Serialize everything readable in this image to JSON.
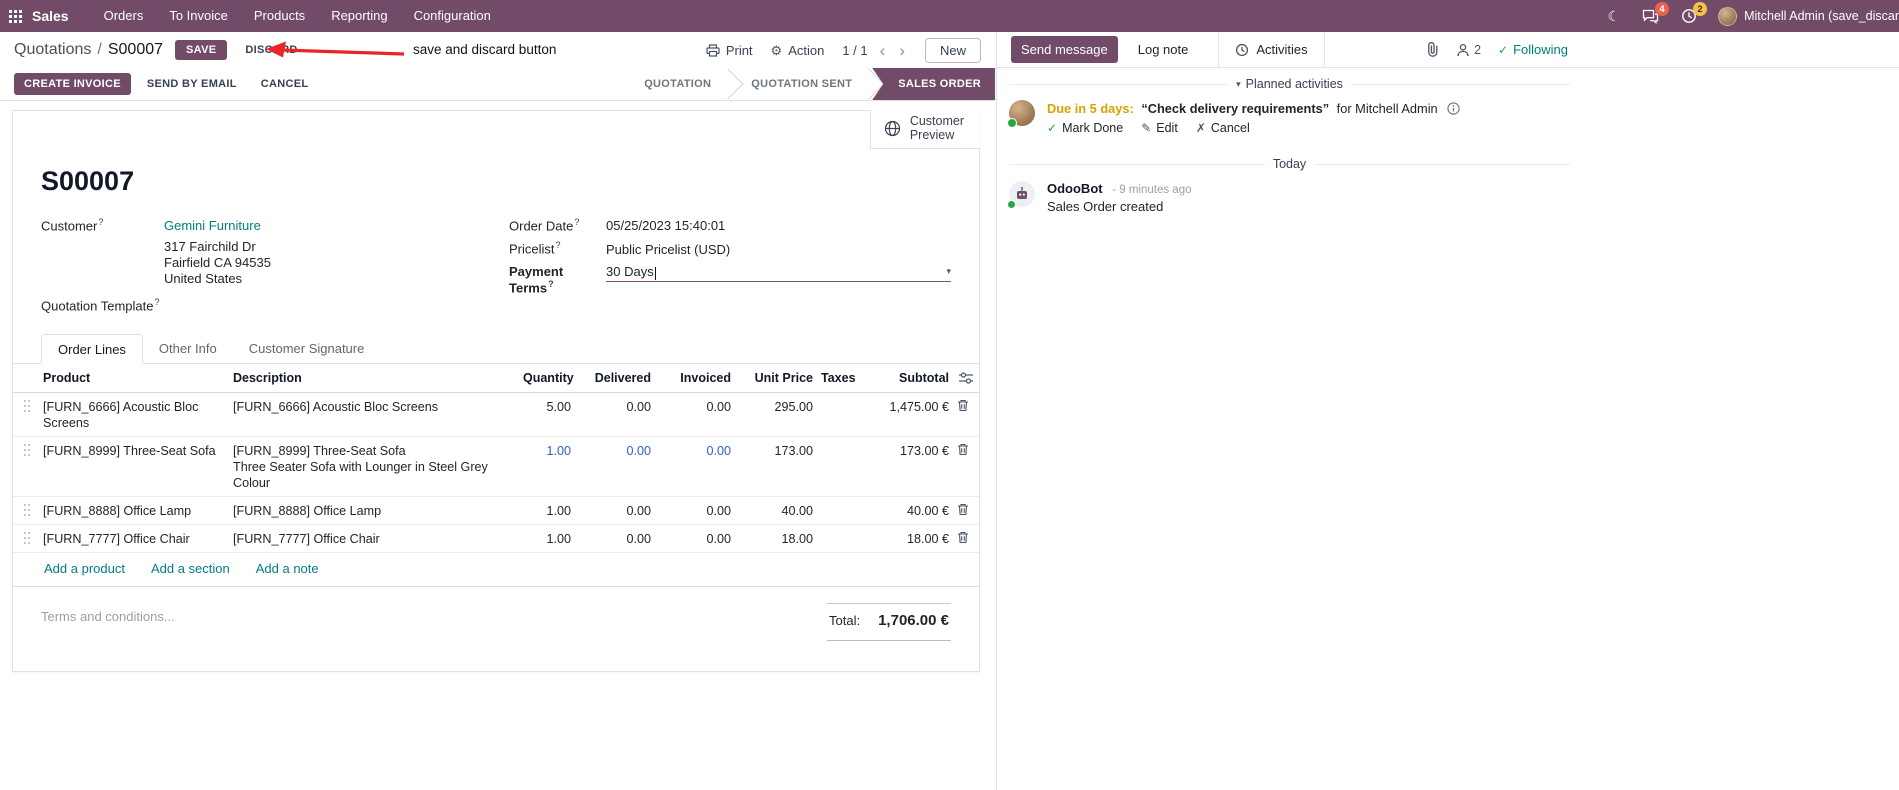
{
  "colors": {
    "primary": "#714B67",
    "link": "#017E84",
    "modified": "#2a5fd0",
    "due": "#d9a300",
    "red": "#e8252b",
    "success": "#28a745"
  },
  "icons": {
    "moon": "☾",
    "gear": "⚙",
    "chevron_left": "‹",
    "chevron_right": "›",
    "check": "✓",
    "pencil": "✎",
    "cross": "✗",
    "caret_down": "▾"
  },
  "navbar": {
    "app_name": "Sales",
    "menu_items": [
      "Orders",
      "To Invoice",
      "Products",
      "Reporting",
      "Configuration"
    ],
    "messages_badge": "4",
    "activities_badge": "2",
    "user_name": "Mitchell Admin (save_discar"
  },
  "breadcrumb": {
    "parent": "Quotations",
    "separator": "/",
    "current": "S00007"
  },
  "control_panel": {
    "save_label": "SAVE",
    "discard_label": "DISCARD",
    "print_label": "Print",
    "action_label": "Action",
    "pager": "1 / 1",
    "new_label": "New"
  },
  "annotation": {
    "text": "save and discard button"
  },
  "statusbar": {
    "buttons": [
      "CREATE INVOICE",
      "SEND BY EMAIL",
      "CANCEL"
    ],
    "states": [
      {
        "label": "QUOTATION",
        "active": false
      },
      {
        "label": "QUOTATION SENT",
        "active": false
      },
      {
        "label": "SALES ORDER",
        "active": true
      }
    ]
  },
  "sheet": {
    "customer_preview": {
      "line1": "Customer",
      "line2": "Preview"
    },
    "title": "S00007",
    "fields": {
      "help_marker": "?",
      "customer_label": "Customer",
      "customer_value": "Gemini Furniture",
      "address_lines": [
        "317 Fairchild Dr",
        "Fairfield CA 94535",
        "United States"
      ],
      "quotation_template_label": "Quotation Template",
      "order_date_label": "Order Date",
      "order_date_value": "05/25/2023 15:40:01",
      "pricelist_label": "Pricelist",
      "pricelist_value": "Public Pricelist (USD)",
      "payment_terms_label": "Payment Terms",
      "payment_terms_value": "30 Days"
    },
    "tabs": [
      {
        "label": "Order Lines",
        "active": true
      },
      {
        "label": "Other Info",
        "active": false
      },
      {
        "label": "Customer Signature",
        "active": false
      }
    ],
    "table": {
      "headers": [
        "Product",
        "Description",
        "Quantity",
        "Delivered",
        "Invoiced",
        "Unit Price",
        "Taxes",
        "Subtotal"
      ],
      "rows": [
        {
          "product": "[FURN_6666] Acoustic Bloc Screens",
          "description": [
            "[FURN_6666] Acoustic Bloc Screens"
          ],
          "quantity": "5.00",
          "delivered": "0.00",
          "invoiced": "0.00",
          "unit_price": "295.00",
          "taxes": "",
          "subtotal": "1,475.00 €"
        },
        {
          "product": "[FURN_8999] Three-Seat Sofa",
          "description": [
            "[FURN_8999] Three-Seat Sofa",
            "Three Seater Sofa with Lounger in Steel Grey Colour"
          ],
          "quantity": "1.00",
          "delivered": "0.00",
          "invoiced": "0.00",
          "unit_price": "173.00",
          "taxes": "",
          "subtotal": "173.00 €"
        },
        {
          "product": "[FURN_8888] Office Lamp",
          "description": [
            "[FURN_8888] Office Lamp"
          ],
          "quantity": "1.00",
          "delivered": "0.00",
          "invoiced": "0.00",
          "unit_price": "40.00",
          "taxes": "",
          "subtotal": "40.00 €"
        },
        {
          "product": "[FURN_7777] Office Chair",
          "description": [
            "[FURN_7777] Office Chair"
          ],
          "quantity": "1.00",
          "delivered": "0.00",
          "invoiced": "0.00",
          "unit_price": "18.00",
          "taxes": "",
          "subtotal": "18.00 €"
        }
      ],
      "footer_links": [
        "Add a product",
        "Add a section",
        "Add a note"
      ]
    },
    "terms_placeholder": "Terms and conditions...",
    "total_label": "Total:",
    "total_value": "1,706.00 €"
  },
  "chatter": {
    "send_message_label": "Send message",
    "log_note_label": "Log note",
    "activities_label": "Activities",
    "followers_count": "2",
    "following_label": "Following",
    "planned": {
      "header": "Planned activities",
      "due": "Due in 5 days:",
      "summary": "“Check delivery requirements”",
      "assignee": "for Mitchell Admin",
      "mark_done": "Mark Done",
      "edit": "Edit",
      "cancel": "Cancel"
    },
    "today_label": "Today",
    "message": {
      "author": "OdooBot",
      "time": "- 9 minutes ago",
      "body": "Sales Order created"
    }
  }
}
